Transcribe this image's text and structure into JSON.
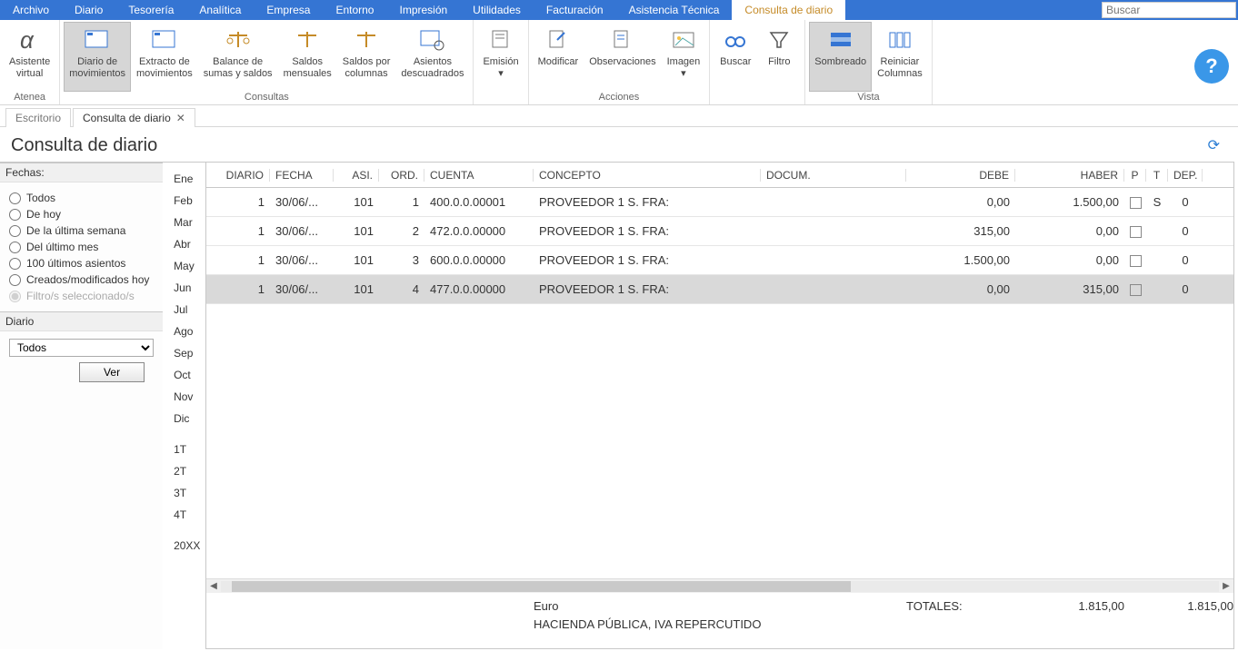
{
  "menu": {
    "items": [
      "Archivo",
      "Diario",
      "Tesorería",
      "Analítica",
      "Empresa",
      "Entorno",
      "Impresión",
      "Utilidades",
      "Facturación",
      "Asistencia Técnica",
      "Consulta de diario"
    ],
    "activeIndex": 10,
    "search_placeholder": "Buscar"
  },
  "ribbon": {
    "groups": [
      {
        "title": "Atenea",
        "items": [
          {
            "label": "Asistente\nvirtual",
            "name": "asistente-virtual"
          }
        ]
      },
      {
        "title": "Consultas",
        "items": [
          {
            "label": "Diario de\nmovimientos",
            "name": "diario-movimientos",
            "active": true
          },
          {
            "label": "Extracto de\nmovimientos",
            "name": "extracto-movimientos"
          },
          {
            "label": "Balance de\nsumas y saldos",
            "name": "balance-sumas-saldos"
          },
          {
            "label": "Saldos\nmensuales",
            "name": "saldos-mensuales"
          },
          {
            "label": "Saldos por\ncolumnas",
            "name": "saldos-columnas"
          },
          {
            "label": "Asientos\ndescuadrados",
            "name": "asientos-descuadrados"
          }
        ]
      },
      {
        "title": "",
        "items": [
          {
            "label": "Emisión\n▾",
            "name": "emision"
          }
        ]
      },
      {
        "title": "Acciones",
        "items": [
          {
            "label": "Modificar",
            "name": "modificar"
          },
          {
            "label": "Observaciones",
            "name": "observaciones"
          },
          {
            "label": "Imagen\n▾",
            "name": "imagen"
          }
        ]
      },
      {
        "title": "",
        "items": [
          {
            "label": "Buscar",
            "name": "buscar"
          },
          {
            "label": "Filtro",
            "name": "filtro"
          }
        ]
      },
      {
        "title": "Vista",
        "items": [
          {
            "label": "Sombreado",
            "name": "sombreado",
            "active": true
          },
          {
            "label": "Reiniciar\nColumnas",
            "name": "reiniciar-columnas"
          }
        ]
      }
    ]
  },
  "doc_tabs": [
    {
      "label": "Escritorio",
      "closable": false
    },
    {
      "label": "Consulta de diario",
      "closable": true
    }
  ],
  "page_title": "Consulta de diario",
  "filter": {
    "fechas_title": "Fechas:",
    "options": [
      "Todos",
      "De hoy",
      "De la última semana",
      "Del último mes",
      "100 últimos asientos",
      "Creados/modificados hoy",
      "Filtro/s seleccionado/s"
    ],
    "diario_title": "Diario",
    "diario_value": "Todos",
    "ver_label": "Ver"
  },
  "months": [
    "Ene",
    "Feb",
    "Mar",
    "Abr",
    "May",
    "Jun",
    "Jul",
    "Ago",
    "Sep",
    "Oct",
    "Nov",
    "Dic",
    "",
    "1T",
    "2T",
    "3T",
    "4T",
    "",
    "20XX"
  ],
  "grid": {
    "headers": [
      "DIARIO",
      "FECHA",
      "ASI.",
      "ORD.",
      "CUENTA",
      "CONCEPTO",
      "DOCUM.",
      "DEBE",
      "HABER",
      "P",
      "T",
      "DEP."
    ],
    "rows": [
      {
        "diario": "1",
        "fecha": "30/06/...",
        "asi": "101",
        "ord": "1",
        "cuenta": "400.0.0.00001",
        "concepto": "PROVEEDOR 1 S. FRA:",
        "docum": "",
        "debe": "0,00",
        "haber": "1.500,00",
        "p": "☐",
        "t": "S",
        "dep": "0"
      },
      {
        "diario": "1",
        "fecha": "30/06/...",
        "asi": "101",
        "ord": "2",
        "cuenta": "472.0.0.00000",
        "concepto": "PROVEEDOR 1 S. FRA:",
        "docum": "",
        "debe": "315,00",
        "haber": "0,00",
        "p": "☐",
        "t": "",
        "dep": "0"
      },
      {
        "diario": "1",
        "fecha": "30/06/...",
        "asi": "101",
        "ord": "3",
        "cuenta": "600.0.0.00000",
        "concepto": "PROVEEDOR 1 S. FRA:",
        "docum": "",
        "debe": "1.500,00",
        "haber": "0,00",
        "p": "☐",
        "t": "",
        "dep": "0"
      },
      {
        "diario": "1",
        "fecha": "30/06/...",
        "asi": "101",
        "ord": "4",
        "cuenta": "477.0.0.00000",
        "concepto": "PROVEEDOR 1 S. FRA:",
        "docum": "",
        "debe": "0,00",
        "haber": "315,00",
        "p": "☐",
        "t": "",
        "dep": "0",
        "selected": true
      }
    ],
    "currency": "Euro",
    "totals_label": "TOTALES:",
    "total_debe": "1.815,00",
    "total_haber": "1.815,00",
    "footer_note": "HACIENDA PÚBLICA, IVA REPERCUTIDO"
  }
}
